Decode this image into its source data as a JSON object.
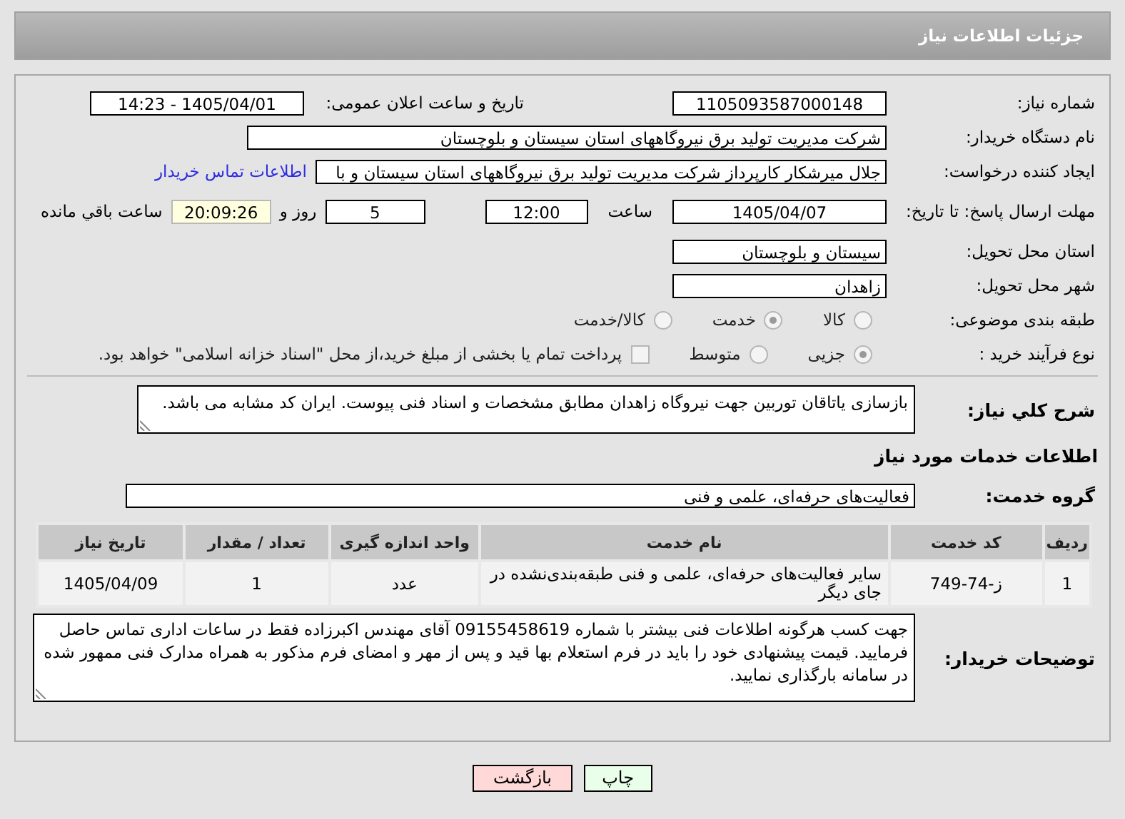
{
  "header": {
    "title": "جزئیات اطلاعات نیاز"
  },
  "need_number": {
    "label": "شماره نیاز:",
    "value": "1105093587000148"
  },
  "announce": {
    "label": "تاریخ و ساعت اعلان عمومی:",
    "value": "1405/04/01 - 14:23"
  },
  "buyer": {
    "label": "نام دستگاه خریدار:",
    "value": "شرکت مدیریت تولید برق نیروگاههای استان سیستان و بلوچستان"
  },
  "creator": {
    "label": "ایجاد کننده درخواست:",
    "value": "جلال میرشکار کارپرداز شرکت مدیریت تولید برق نیروگاههای استان سیستان و با",
    "link": "اطلاعات تماس خریدار"
  },
  "deadline": {
    "label": "مهلت ارسال پاسخ: تا تاریخ:",
    "date": "1405/04/07",
    "time_label": "ساعت",
    "time": "12:00",
    "days": "5",
    "days_label": "روز و",
    "remaining": "20:09:26",
    "remaining_label": "ساعت باقي مانده"
  },
  "province": {
    "label": "استان محل تحویل:",
    "value": "سیستان و بلوچستان"
  },
  "city": {
    "label": "شهر محل تحویل:",
    "value": "زاهدان"
  },
  "category": {
    "label": "طبقه بندی موضوعی:",
    "options": [
      {
        "label": "کالا",
        "selected": false
      },
      {
        "label": "خدمت",
        "selected": true
      },
      {
        "label": "کالا/خدمت",
        "selected": false
      }
    ]
  },
  "process": {
    "label": "نوع فرآیند خرید :",
    "options": [
      {
        "label": "جزیی",
        "selected": true
      },
      {
        "label": "متوسط",
        "selected": false
      }
    ],
    "treasury": {
      "label": "پرداخت تمام یا بخشی از مبلغ خرید،از محل \"اسناد خزانه اسلامی\" خواهد بود.",
      "checked": false
    }
  },
  "description": {
    "label": "شرح کلي نیاز:",
    "value": "بازسازی یاتاقان توربین جهت نیروگاه زاهدان مطابق مشخصات و اسناد فنی پیوست. ایران کد مشابه می باشد."
  },
  "services_heading": "اطلاعات خدمات مورد نیاز",
  "service_group": {
    "label": "گروه خدمت:",
    "value": "فعالیت‌های حرفه‌ای، علمی و فنی"
  },
  "table": {
    "columns": [
      "ردیف",
      "کد خدمت",
      "نام خدمت",
      "واحد اندازه گیری",
      "تعداد / مقدار",
      "تاریخ نیاز"
    ],
    "rows": [
      [
        "1",
        "ز-74-749",
        "سایر فعالیت‌های حرفه‌ای، علمی و فنی طبقه‌بندی‌نشده در جای دیگر",
        "عدد",
        "1",
        "1405/04/09"
      ]
    ]
  },
  "buyer_notes": {
    "label": "توضیحات خریدار:",
    "value": "جهت کسب هرگونه اطلاعات فنی بیشتر با شماره 09155458619 آقای مهندس اکبرزاده فقط در ساعات اداری تماس حاصل فرمایید. قیمت پیشنهادی خود را باید در فرم استعلام بها قید و پس از مهر و امضای فرم مذکور به همراه مدارک فنی ممهور شده در سامانه بارگذاری نمایید."
  },
  "buttons": [
    {
      "label": "چاپ",
      "kind": "print"
    },
    {
      "label": "بازگشت",
      "kind": "back"
    }
  ]
}
